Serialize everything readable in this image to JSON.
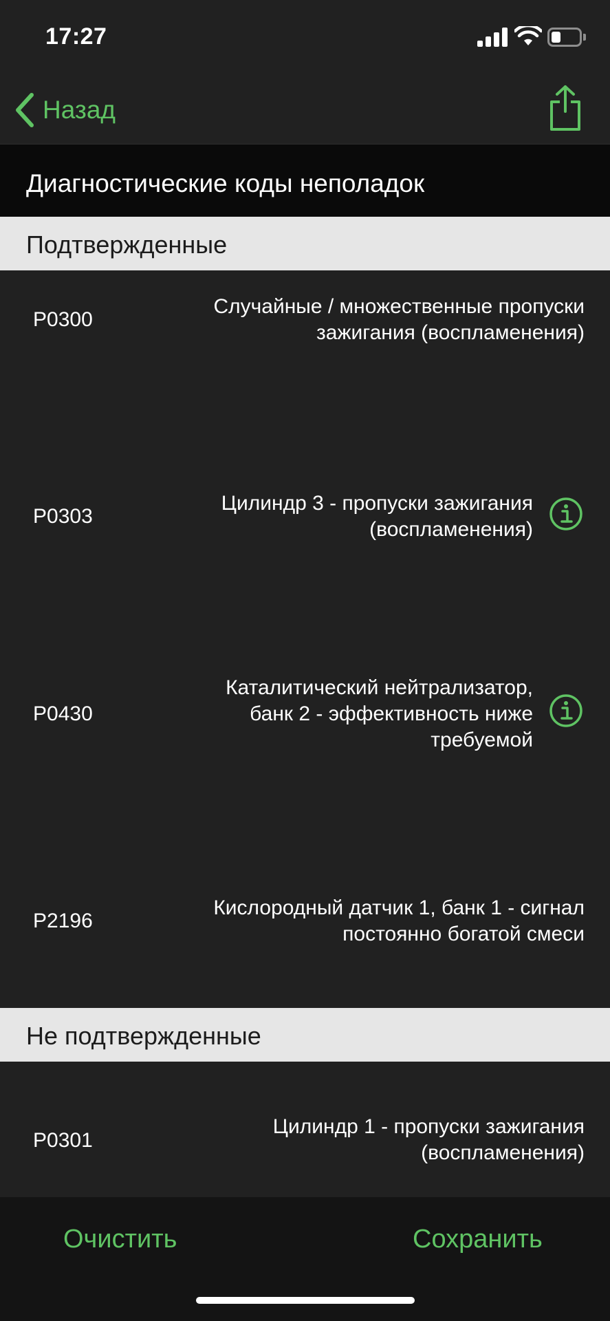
{
  "status_bar": {
    "time": "17:27",
    "battery_level": 0.35
  },
  "nav": {
    "back_label": "Назад",
    "share_icon": "share-icon"
  },
  "title": "Диагностические коды неполадок",
  "sections": {
    "confirmed": {
      "header": "Подтвержденные",
      "items": [
        {
          "code": "P0300",
          "desc_lines": [
            "Случайные / множественные пропуски",
            "зажигания (воспламенения)"
          ],
          "has_info": false
        },
        {
          "code": "P0303",
          "desc_lines": [
            "Цилиндр 3 - пропуски зажигания",
            "(воспламенения)"
          ],
          "has_info": true
        },
        {
          "code": "P0430",
          "desc_lines": [
            "Каталитический нейтрализатор,",
            "банк 2 - эффективность ниже",
            "требуемой"
          ],
          "has_info": true
        },
        {
          "code": "P2196",
          "desc_lines": [
            "Кислородный датчик 1, банк 1 - сигнал",
            "постоянно богатой смеси"
          ],
          "has_info": false
        }
      ]
    },
    "unconfirmed": {
      "header": "Не подтвержденные",
      "items": [
        {
          "code": "P0301",
          "desc_lines": [
            "Цилиндр 1 - пропуски зажигания",
            "(воспламенения)"
          ],
          "has_info": false
        }
      ]
    }
  },
  "toolbar": {
    "clear_label": "Очистить",
    "save_label": "Сохранить"
  },
  "colors": {
    "accent": "#5fc363",
    "background": "#212121",
    "section_header": "#e6e6e6",
    "title_bar": "#0a0a0a"
  }
}
